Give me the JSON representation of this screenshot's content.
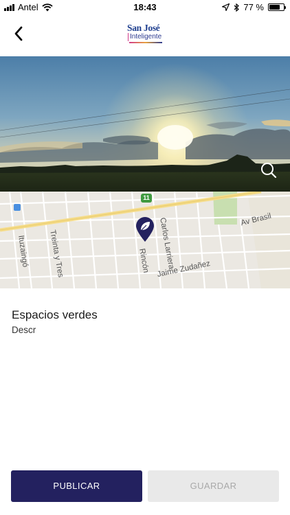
{
  "status_bar": {
    "carrier": "Antel",
    "time": "18:43",
    "battery_percent": "77 %",
    "battery_level": 0.77,
    "icons": [
      "signal-icon",
      "wifi-icon",
      "location-arrow-icon",
      "bluetooth-icon",
      "battery-icon"
    ]
  },
  "nav": {
    "back_icon": "chevron-left-icon",
    "logo": {
      "line1": "San José",
      "line2": "Inteligente"
    }
  },
  "photo": {
    "zoom_icon": "search-icon"
  },
  "map": {
    "route_shield": "11",
    "streets": [
      "Carlos Larriera",
      "Av Brasil",
      "Ituzaingó",
      "Treinta y Tres",
      "Rincón",
      "Jaime Zudañez"
    ],
    "pin_icon": "leaf-pin-icon"
  },
  "details": {
    "title": "Espacios verdes",
    "description": "Descr"
  },
  "actions": {
    "publish_label": "PUBLICAR",
    "save_label": "GUARDAR"
  },
  "colors": {
    "primary": "#23215f",
    "disabled_bg": "#e9e9e9",
    "disabled_text": "#a9a9a9"
  }
}
